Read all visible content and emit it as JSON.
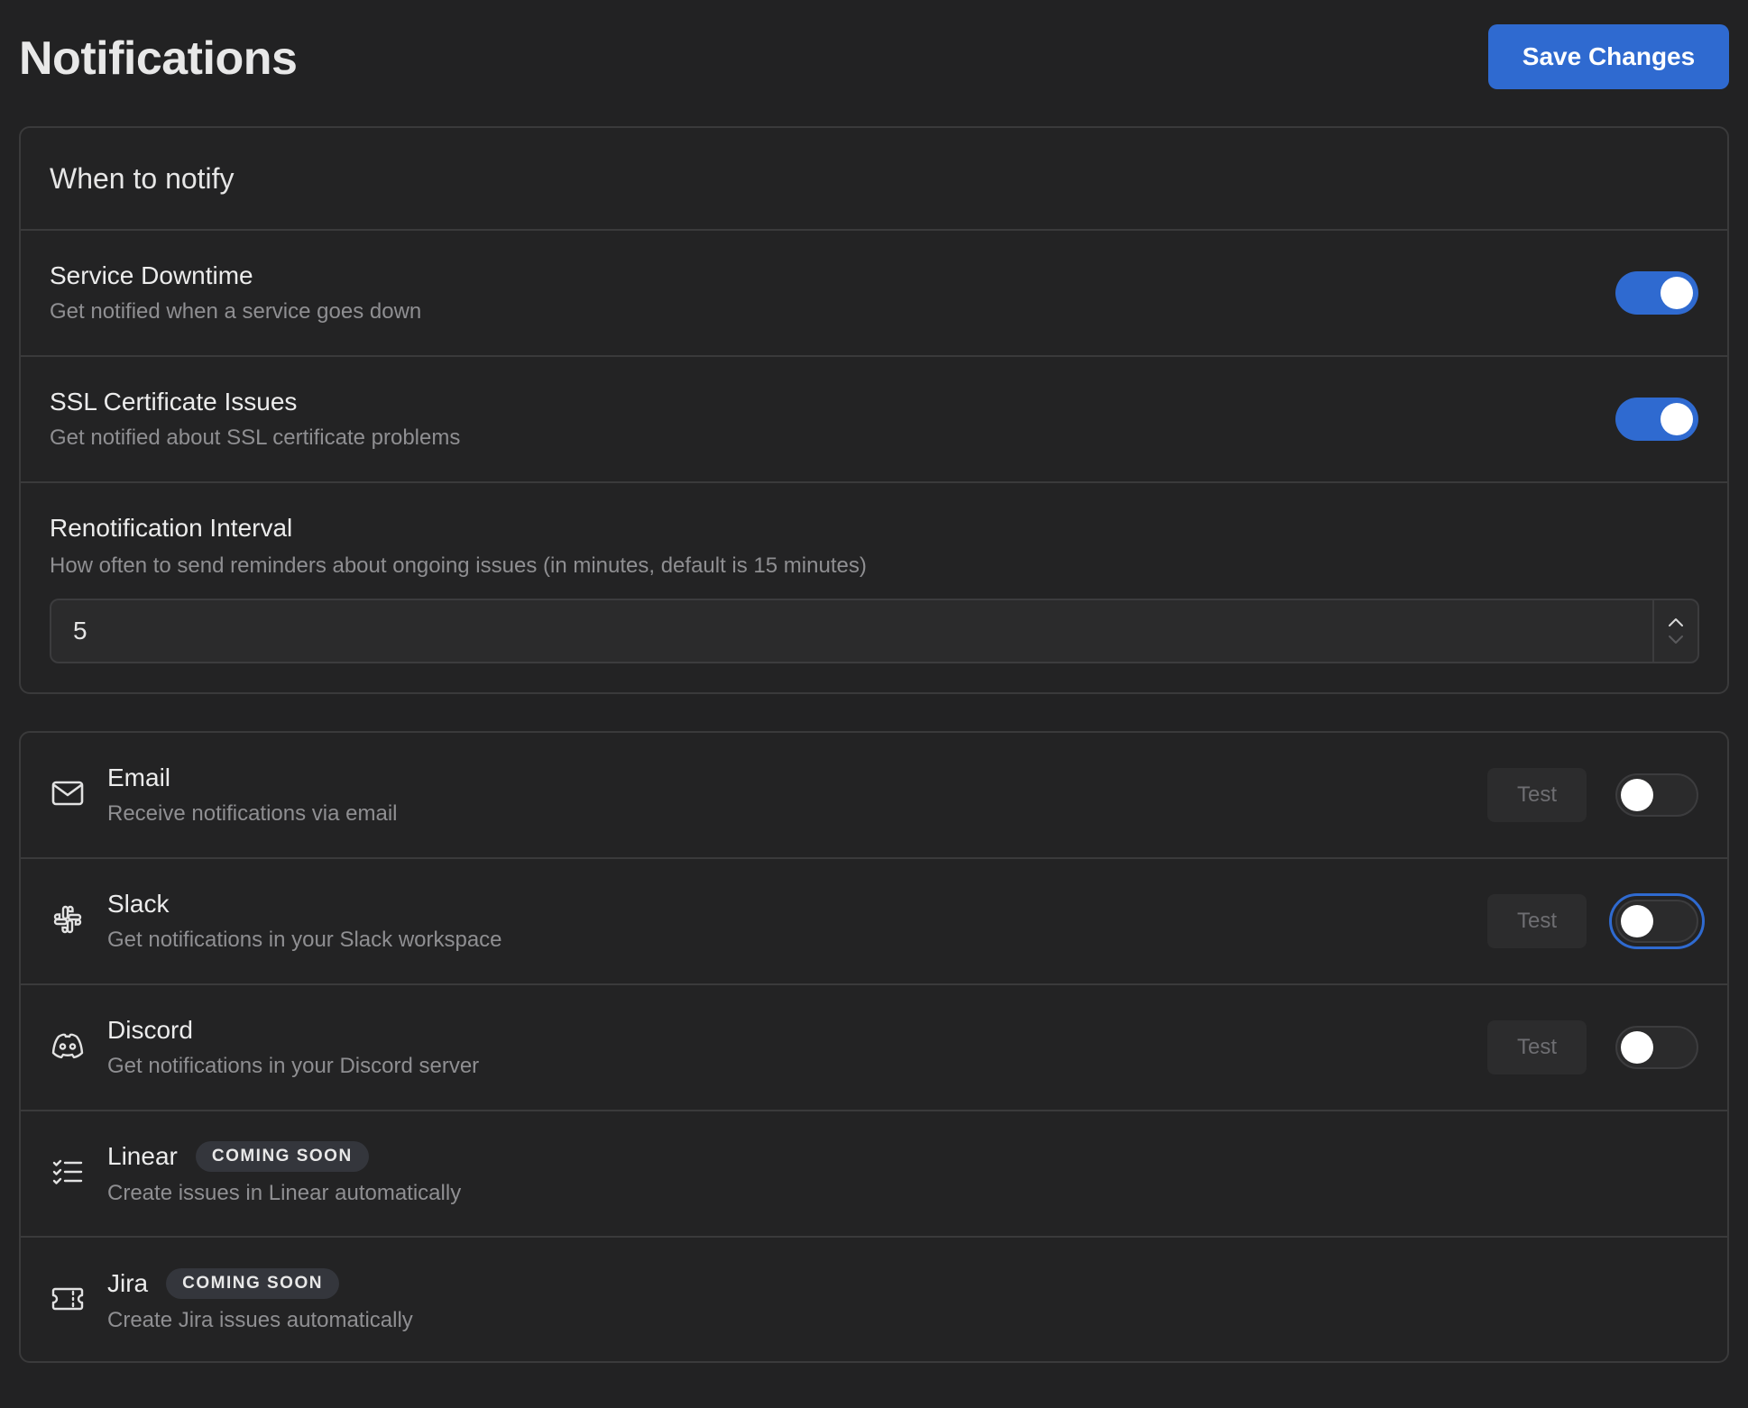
{
  "header": {
    "title": "Notifications",
    "save_label": "Save Changes"
  },
  "when": {
    "heading": "When to notify",
    "items": [
      {
        "title": "Service Downtime",
        "desc": "Get notified when a service goes down",
        "enabled": true
      },
      {
        "title": "SSL Certificate Issues",
        "desc": "Get notified about SSL certificate problems",
        "enabled": true
      }
    ],
    "interval": {
      "title": "Renotification Interval",
      "desc": "How often to send reminders about ongoing issues (in minutes, default is 15 minutes)",
      "value": "5"
    }
  },
  "channels": [
    {
      "title": "Email",
      "desc": "Receive notifications via email",
      "icon": "mail-icon",
      "test_label": "Test",
      "enabled": false
    },
    {
      "title": "Slack",
      "desc": "Get notifications in your Slack workspace",
      "icon": "slack-icon",
      "test_label": "Test",
      "enabled": false,
      "focused": true
    },
    {
      "title": "Discord",
      "desc": "Get notifications in your Discord server",
      "icon": "discord-icon",
      "test_label": "Test",
      "enabled": false
    },
    {
      "title": "Linear",
      "desc": "Create issues in Linear automatically",
      "icon": "list-checks-icon",
      "badge": "COMING SOON"
    },
    {
      "title": "Jira",
      "desc": "Create Jira issues automatically",
      "icon": "ticket-icon",
      "badge": "COMING SOON"
    }
  ],
  "colors": {
    "background": "#222223",
    "accent": "#2f6ad0",
    "border": "#3a3a3b",
    "muted_text": "#8f8f92"
  }
}
